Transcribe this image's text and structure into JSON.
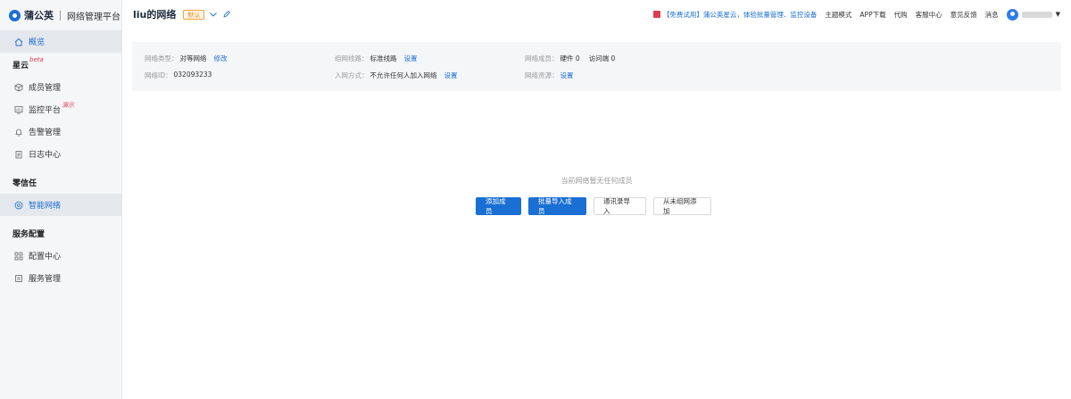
{
  "app": {
    "name": "蒲公英",
    "subtitle": "网络管理平台"
  },
  "sidebar": {
    "overview": "概览",
    "sections": [
      {
        "title": "星云",
        "sup": "beta",
        "items": [
          {
            "label": "成员管理",
            "icon": "cube-icon"
          },
          {
            "label": "监控平台",
            "icon": "monitor-icon",
            "sup": "演示"
          },
          {
            "label": "告警管理",
            "icon": "bell-icon"
          },
          {
            "label": "日志中心",
            "icon": "clipboard-icon"
          }
        ]
      },
      {
        "title": "零信任",
        "items": [
          {
            "label": "智能网络",
            "icon": "network-icon",
            "active": true
          }
        ]
      },
      {
        "title": "服务配置",
        "items": [
          {
            "label": "配置中心",
            "icon": "grid-icon"
          },
          {
            "label": "服务管理",
            "icon": "list-icon"
          }
        ]
      }
    ]
  },
  "header": {
    "network_name": "liu的网络",
    "default_badge": "默认",
    "promo": "【免费试用】蒲公英星云，体验批量管理、监控设备",
    "links": [
      "主题模式",
      "APP下载",
      "代购",
      "客服中心",
      "意见反馈",
      "消息"
    ]
  },
  "info": {
    "net_type_label": "网络类型：",
    "net_type_value": "对等网络",
    "net_type_link": "修改",
    "net_id_label": "网络ID：",
    "net_id_value": "032093233",
    "route_label": "组网线路：",
    "route_value": "标准线路",
    "route_link": "设置",
    "join_label": "入网方式：",
    "join_value": "不允许任何人加入网络",
    "join_link": "设置",
    "members_label": "网络成员：",
    "members_hw": "硬件 0",
    "members_visitor": "访问端 0",
    "resource_label": "网络资源：",
    "resource_link": "设置"
  },
  "empty": {
    "message": "当前网络暂无任何成员",
    "buttons": [
      "添加成员",
      "批量导入成员",
      "通讯录导入",
      "从未组网添加"
    ]
  },
  "colors": {
    "accent": "#1a6fd4",
    "badge": "#f0a33a",
    "promo_icon": "#e03c52"
  }
}
